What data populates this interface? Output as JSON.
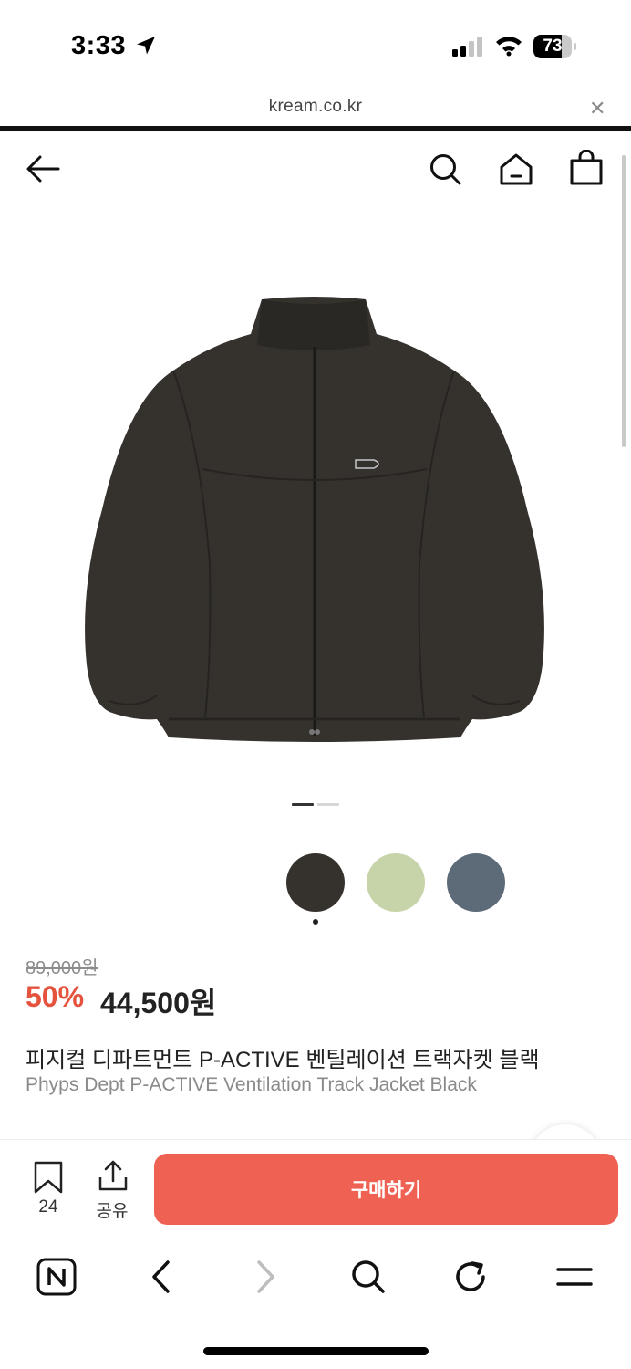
{
  "status_bar": {
    "time": "3:33",
    "battery": "73",
    "battery_level": 0.73,
    "icons": [
      "location-arrow-icon",
      "signal-icon",
      "wifi-icon",
      "battery-icon"
    ]
  },
  "browser": {
    "url": "kream.co.kr",
    "close_icon": "close-icon",
    "toolbar_icons": [
      "naver-icon",
      "back-chevron-icon",
      "forward-chevron-icon",
      "search-icon",
      "reload-icon",
      "menu-icon"
    ]
  },
  "header": {
    "icons": [
      "back-arrow-icon",
      "search-icon",
      "home-icon",
      "shopping-bag-icon"
    ]
  },
  "gallery": {
    "current_index": 1,
    "total": 2
  },
  "color_options": [
    {
      "name": "black",
      "color": "#35322e",
      "selected": true
    },
    {
      "name": "green",
      "color": "#c7d3a8",
      "selected": false
    },
    {
      "name": "grey",
      "color": "#5d6b78",
      "selected": false
    }
  ],
  "product": {
    "original_price": "89,000원",
    "discount": "50%",
    "price": "44,500원",
    "name_ko": "피지컬 디파트먼트 P-ACTIVE 벤틸레이션 트랙자켓 블랙",
    "name_en": "Phyps Dept P-ACTIVE Ventilation Track Jacket Black"
  },
  "actions": {
    "wish_count": "24",
    "share_label": "공유",
    "buy_label": "구매하기"
  },
  "colors": {
    "accent": "#ef6253",
    "discount": "#e5533f",
    "jacket": "#35322e"
  }
}
